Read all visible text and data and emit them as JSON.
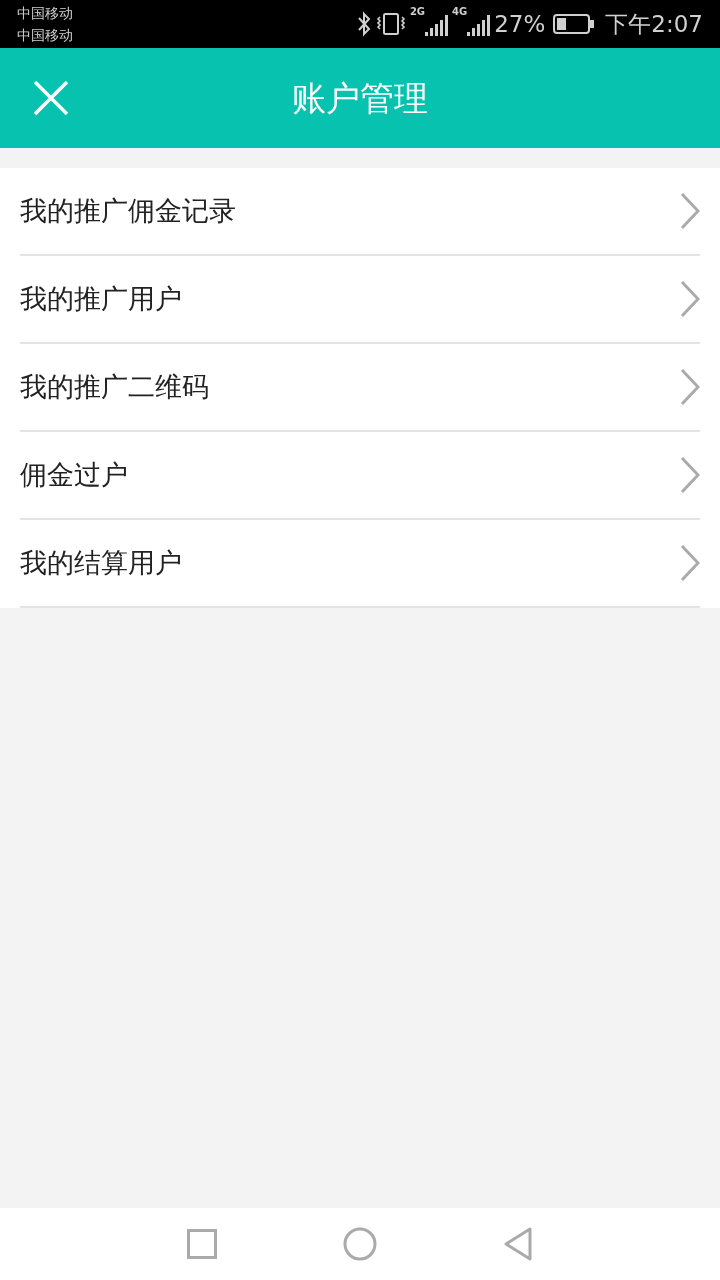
{
  "status_bar": {
    "carriers": [
      "中国移动",
      "中国移动"
    ],
    "networks": [
      "2G",
      "4G"
    ],
    "battery": "27%",
    "time": "下午2:07"
  },
  "header": {
    "title": "账户管理"
  },
  "menu": [
    {
      "label": "我的推广佣金记录"
    },
    {
      "label": "我的推广用户"
    },
    {
      "label": "我的推广二维码"
    },
    {
      "label": "佣金过户"
    },
    {
      "label": "我的结算用户"
    }
  ]
}
